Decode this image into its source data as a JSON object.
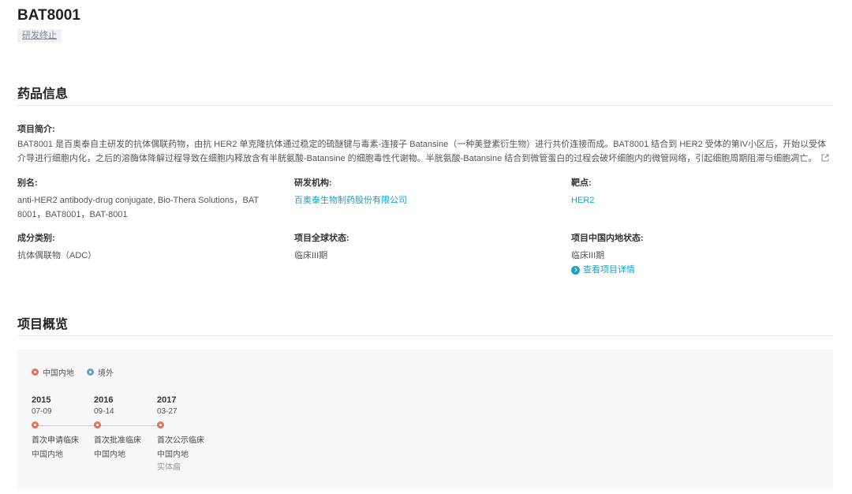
{
  "header": {
    "title": "BAT8001",
    "status": "研发终止"
  },
  "drug_info": {
    "section_title": "药品信息",
    "intro_label": "项目简介:",
    "intro_text": "BAT8001 是百奥泰自主研发的抗体偶联药物，由抗 HER2 单克隆抗体通过稳定的硫醚键与毒素-连接子 Batansine（一种美登素衍生物）进行共价连接而成。BAT8001 结合到 HER2 受体的第IV小区后，开始以受体介导进行细胞内化，之后的溶酶体降解过程导致在细胞内释放含有半胱氨酸-Batansine 的细胞毒性代谢物。半胱氨酸-Batansine 结合到微管蛋白的过程会破坏细胞内的微管网络，引起细胞周期阻滞与细胞凋亡。",
    "alias_label": "别名:",
    "alias_value": "anti-HER2 antibody-drug conjugate, Bio-Thera Solutions，BAT 8001，BAT8001，BAT-8001",
    "org_label": "研发机构:",
    "org_value": "百奥泰生物制药股份有限公司",
    "target_label": "靶点:",
    "target_value": "HER2",
    "component_label": "成分类别:",
    "component_value": "抗体偶联物（ADC）",
    "global_status_label": "项目全球状态:",
    "global_status_value": "临床III期",
    "china_status_label": "项目中国内地状态:",
    "china_status_value": "临床III期",
    "detail_link": "查看项目详情"
  },
  "overview": {
    "section_title": "项目概览",
    "legend": [
      {
        "label": "中国内地",
        "color": "#e8715a"
      },
      {
        "label": "境外",
        "color": "#6e9fc2"
      }
    ],
    "events": [
      {
        "year": "2015",
        "date": "07-09",
        "title": "首次申请临床",
        "region": "中国内地",
        "extra": ""
      },
      {
        "year": "2016",
        "date": "09-14",
        "title": "首次批准临床",
        "region": "中国内地",
        "extra": ""
      },
      {
        "year": "2017",
        "date": "03-27",
        "title": "首次公示临床",
        "region": "中国内地",
        "extra": "实体瘤"
      }
    ]
  },
  "colors": {
    "accent": "#1aa0c6",
    "china_marker": "#e8715a",
    "overseas_marker": "#6e9fc2"
  }
}
